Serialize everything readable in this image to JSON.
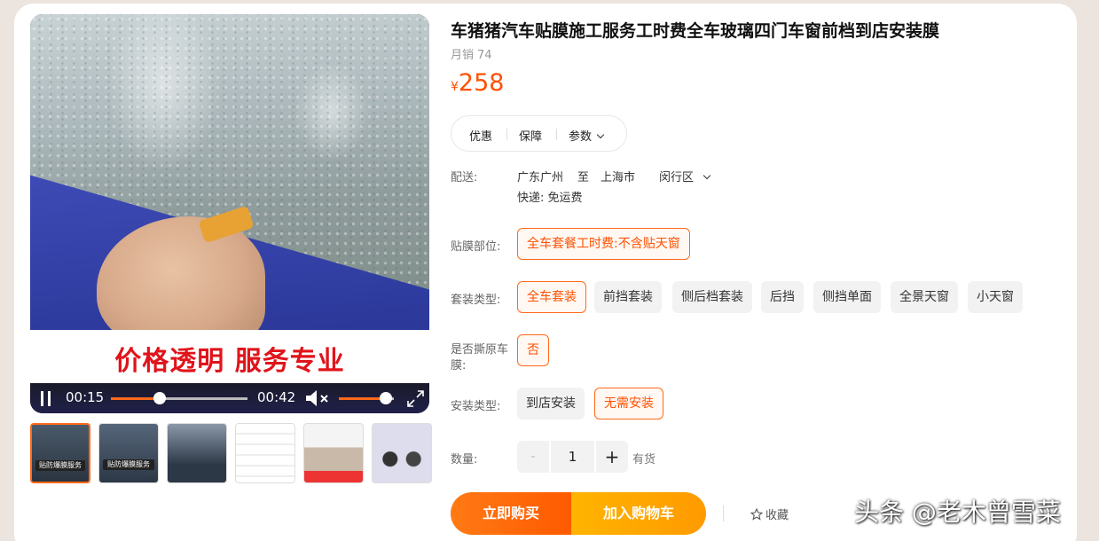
{
  "product": {
    "title": "车猪猪汽车贴膜施工服务工时费全车玻璃四门车窗前档到店安装膜",
    "sales_label": "月销",
    "sales_count": "74",
    "price_currency": "¥",
    "price_value": "258"
  },
  "video": {
    "overlay_text": "价格透明 服务专业",
    "current_time": "00:15",
    "total_time": "00:42",
    "progress_fraction": 0.36,
    "volume_fraction": 0.85
  },
  "thumbnails": [
    {
      "caption": "贴防爆膜服务",
      "active": true
    },
    {
      "caption": "贴防爆膜服务",
      "active": false
    },
    {
      "caption": "",
      "active": false
    },
    {
      "caption": "",
      "active": false
    },
    {
      "caption": "",
      "active": false
    },
    {
      "caption": "",
      "active": false
    }
  ],
  "tabs": {
    "promo": "优惠",
    "guarantee": "保障",
    "params": "参数"
  },
  "shipping": {
    "label": "配送:",
    "from": "广东广州",
    "to_word": "至",
    "city": "上海市",
    "district": "闵行区",
    "fee": "快递: 免运费"
  },
  "options": {
    "position_label": "贴膜部位:",
    "position_value": "全车套餐工时费:不含贴天窗",
    "package_label": "套装类型:",
    "packages": [
      "全车套装",
      "前挡套装",
      "侧后档套装",
      "后挡",
      "侧挡单面",
      "全景天窗",
      "小天窗"
    ],
    "tear_label": "是否撕原车膜:",
    "tear_value": "否",
    "install_label": "安装类型:",
    "install_options": [
      "到店安装",
      "无需安装"
    ]
  },
  "quantity": {
    "label": "数量:",
    "minus": "-",
    "value": "1",
    "plus": "+",
    "stock": "有货"
  },
  "actions": {
    "buy_now": "立即购买",
    "add_cart": "加入购物车",
    "favorite": "收藏"
  },
  "watermark": "头条 @老木曾雪菜"
}
